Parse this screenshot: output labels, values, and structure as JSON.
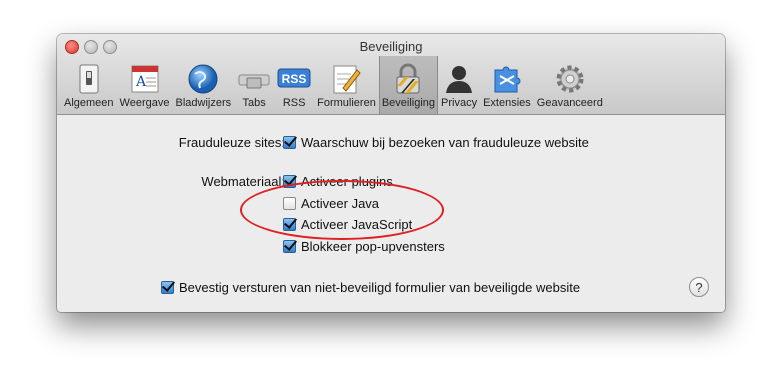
{
  "window": {
    "title": "Beveiliging"
  },
  "toolbar": {
    "items": [
      {
        "label": "Algemeen",
        "icon": "switch-icon"
      },
      {
        "label": "Weergave",
        "icon": "font-icon"
      },
      {
        "label": "Bladwijzers",
        "icon": "globe-icon"
      },
      {
        "label": "Tabs",
        "icon": "tabs-icon"
      },
      {
        "label": "RSS",
        "icon": "rss-icon",
        "rss_text": "RSS"
      },
      {
        "label": "Formulieren",
        "icon": "pencil-icon"
      },
      {
        "label": "Beveiliging",
        "icon": "lock-icon",
        "selected": true
      },
      {
        "label": "Privacy",
        "icon": "person-icon"
      },
      {
        "label": "Extensies",
        "icon": "puzzle-icon"
      },
      {
        "label": "Geavanceerd",
        "icon": "gear-icon"
      }
    ]
  },
  "fraud": {
    "label": "Frauduleuze sites:",
    "checkbox_label": "Waarschuw bij bezoeken van frauduleuze website",
    "checked": true
  },
  "web": {
    "label": "Webmateriaal:",
    "options": [
      {
        "label": "Activeer plugins",
        "checked": true
      },
      {
        "label": "Activeer Java",
        "checked": false
      },
      {
        "label": "Activeer JavaScript",
        "checked": true
      },
      {
        "label": "Blokkeer pop-upvensters",
        "checked": true
      }
    ]
  },
  "confirm": {
    "label": "Bevestig versturen van niet-beveiligd formulier van beveiligde website",
    "checked": true
  },
  "help": {
    "label": "?"
  },
  "colors": {
    "highlight_ellipse": "#e02020",
    "checkbox_on": "#2f7ecf"
  }
}
